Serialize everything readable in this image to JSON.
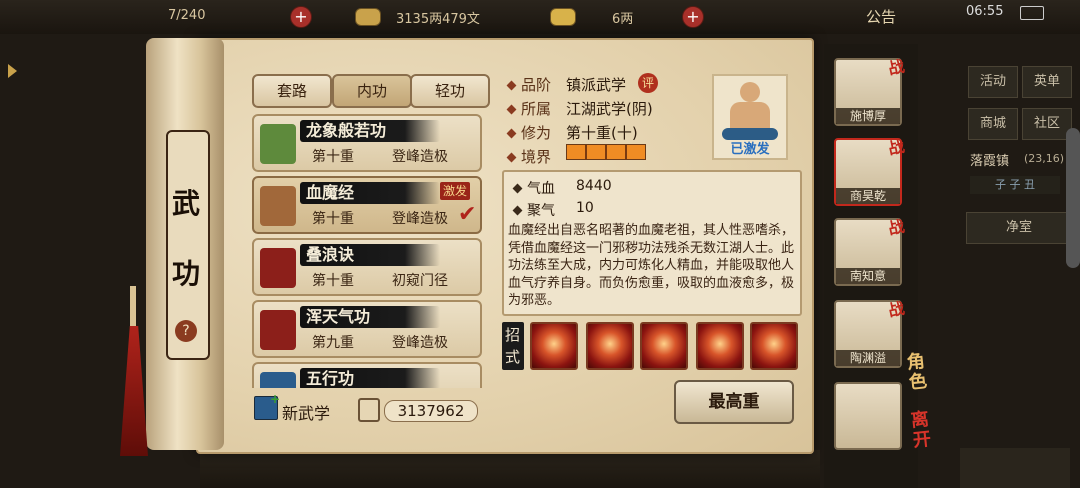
{
  "topbar": {
    "stamina": "7/240",
    "money": "3135两479文",
    "premium": "6两",
    "announcement": "公告",
    "time": "06:55"
  },
  "right_menu": {
    "activity": "活动",
    "leaderboard": "英单",
    "shop": "商城",
    "community": "社区",
    "location": "落霞镇",
    "coords": "(23,16)",
    "period": "子 子 丑",
    "room": "净室"
  },
  "scroll": {
    "title_char1": "武",
    "title_char2": "功",
    "help": "?"
  },
  "tabs": [
    "套路",
    "内功",
    "轻功"
  ],
  "skills": [
    {
      "name": "龙象般若功",
      "level": "第十重",
      "rank": "登峰造极",
      "badge": "",
      "color": "#5e8a3c"
    },
    {
      "name": "血魔经",
      "level": "第十重",
      "rank": "登峰造极",
      "badge": "激发",
      "color": "#a1683a"
    },
    {
      "name": "叠浪诀",
      "level": "第十重",
      "rank": "初窥门径",
      "badge": "",
      "color": "#8c1f1a"
    },
    {
      "name": "浑天气功",
      "level": "第九重",
      "rank": "登峰造极",
      "badge": "",
      "color": "#8c1f1a"
    },
    {
      "name": "五行功",
      "level": "",
      "rank": "",
      "badge": "",
      "color": "#2a5c8c"
    }
  ],
  "new_skill": "新武学",
  "points": "3137962",
  "detail": {
    "grade_label": "品阶",
    "grade": "镇派武学",
    "grade_badge": "评",
    "sect_label": "所属",
    "sect": "江湖武学(阴)",
    "cultivation_label": "修为",
    "cultivation": "第十重(十)",
    "realm_label": "境界",
    "realm_level": 1.0,
    "activated": "已激发",
    "hp_label": "气血",
    "hp": "8440",
    "focus_label": "聚气",
    "focus": "10",
    "description": "血魔经出自恶名昭著的血魔老祖，其人性恶嗜杀，凭借血魔经这一门邪秽功法残杀无数江湖人士。此功法练至大成，内力可炼化人精血，并能吸取他人血气疗养自身。而负伤愈重，吸取的血液愈多，极为邪恶。",
    "moves_label_1": "招",
    "moves_label_2": "式",
    "max_button": "最高重"
  },
  "party": [
    {
      "name": "施博厚",
      "battle": "战"
    },
    {
      "name": "商昊乾",
      "battle": "战"
    },
    {
      "name": "南知意",
      "battle": "战"
    },
    {
      "name": "陶渊溢",
      "battle": "战"
    },
    {
      "name": "",
      "battle": ""
    }
  ],
  "side_actions": {
    "role": "角色",
    "leave": "离开"
  },
  "colors": {
    "accent_red": "#c2281c",
    "paper": "#e7d7b6",
    "brush": "#111111",
    "realm_bar": "#e07a18"
  }
}
